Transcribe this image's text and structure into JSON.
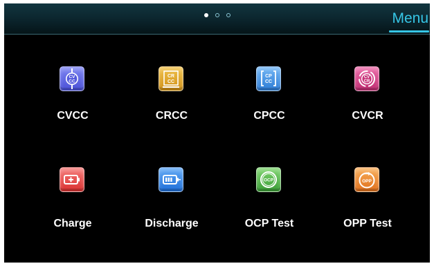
{
  "header": {
    "menu_label": "Menu",
    "page_indicator": {
      "count": 3,
      "active_index": 0
    },
    "accent_color": "#36c6e6"
  },
  "tiles": [
    {
      "label": "CVCC",
      "icon": "cvcc-icon",
      "icon_text": [
        "CV",
        "CC"
      ],
      "color": "#5d63e0"
    },
    {
      "label": "CRCC",
      "icon": "crcc-icon",
      "icon_text": [
        "CR",
        "CC"
      ],
      "color": "#d9a227"
    },
    {
      "label": "CPCC",
      "icon": "cpcc-icon",
      "icon_text": [
        "CP",
        "CC"
      ],
      "color": "#3f8fe0"
    },
    {
      "label": "CVCR",
      "icon": "cvcr-icon",
      "icon_text": [
        "CV",
        "CR"
      ],
      "color": "#d23f86"
    },
    {
      "label": "Charge",
      "icon": "battery-charge-icon",
      "icon_text": [],
      "color": "#e3403f"
    },
    {
      "label": "Discharge",
      "icon": "battery-discharge-icon",
      "icon_text": [],
      "color": "#2c7fe6"
    },
    {
      "label": "OCP Test",
      "icon": "ocp-test-icon",
      "icon_text": [
        "OCP"
      ],
      "color": "#4cb248"
    },
    {
      "label": "OPP Test",
      "icon": "opp-test-icon",
      "icon_text": [
        "OPP"
      ],
      "color": "#ef8a2d"
    }
  ]
}
